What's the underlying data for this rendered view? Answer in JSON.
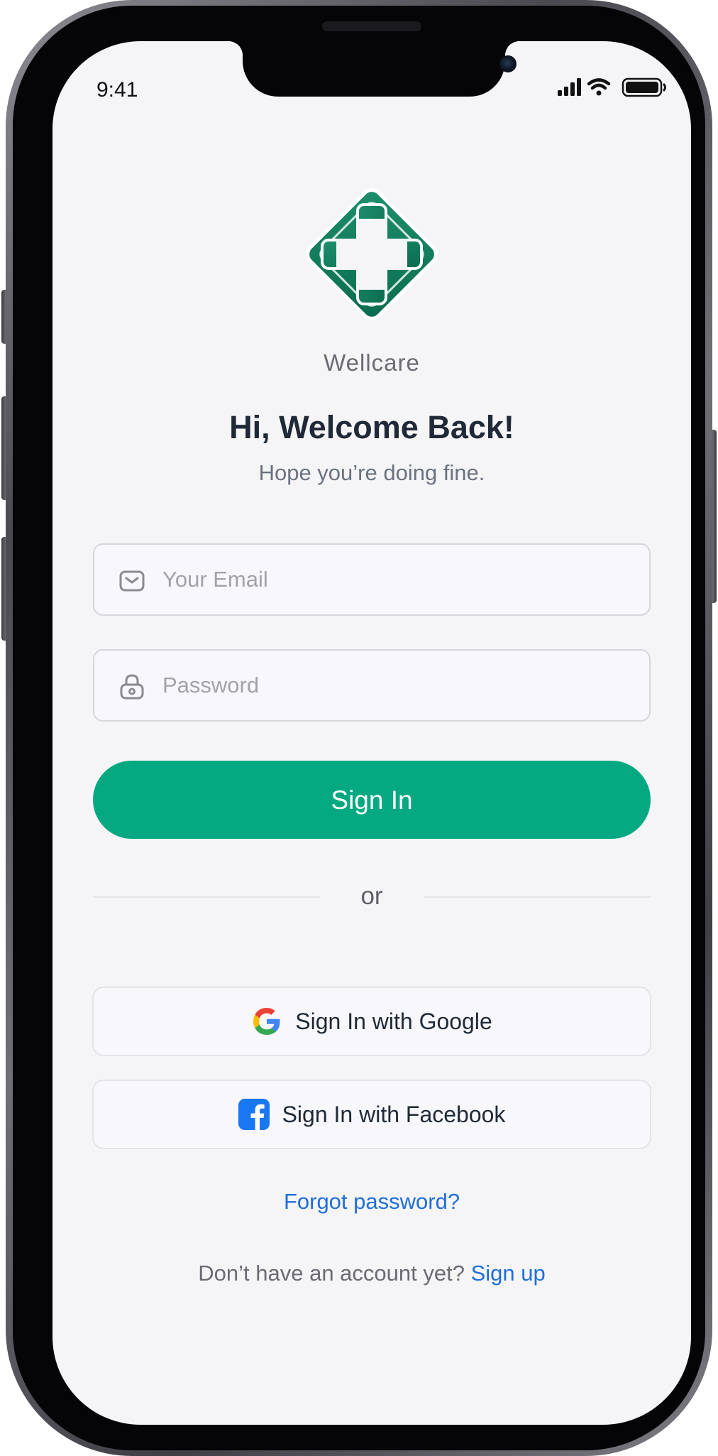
{
  "status_bar": {
    "time": "9:41",
    "icons": [
      "cellular-signal-icon",
      "wifi-icon",
      "battery-icon"
    ]
  },
  "brand": {
    "name": "Wellcare",
    "logo_icon": "medical-cross-logo",
    "logo_color": "#0f7a5c"
  },
  "header": {
    "title": "Hi, Welcome Back!",
    "subtitle": "Hope you’re doing fine."
  },
  "form": {
    "email": {
      "placeholder": "Your Email",
      "value": "",
      "icon": "mail-icon"
    },
    "password": {
      "placeholder": "Password",
      "value": "",
      "icon": "lock-icon"
    },
    "submit_label": "Sign In"
  },
  "divider": {
    "label": "or"
  },
  "social": {
    "google_label": "Sign In with Google",
    "facebook_label": "Sign In with Facebook"
  },
  "links": {
    "forgot_password": "Forgot password?",
    "no_account_text": "Don’t have an account yet?",
    "signup": "Sign up"
  },
  "colors": {
    "primary": "#04a981",
    "link": "#1f6fd8",
    "screen_background": "#f5f4f7",
    "facebook": "#1877f2"
  }
}
